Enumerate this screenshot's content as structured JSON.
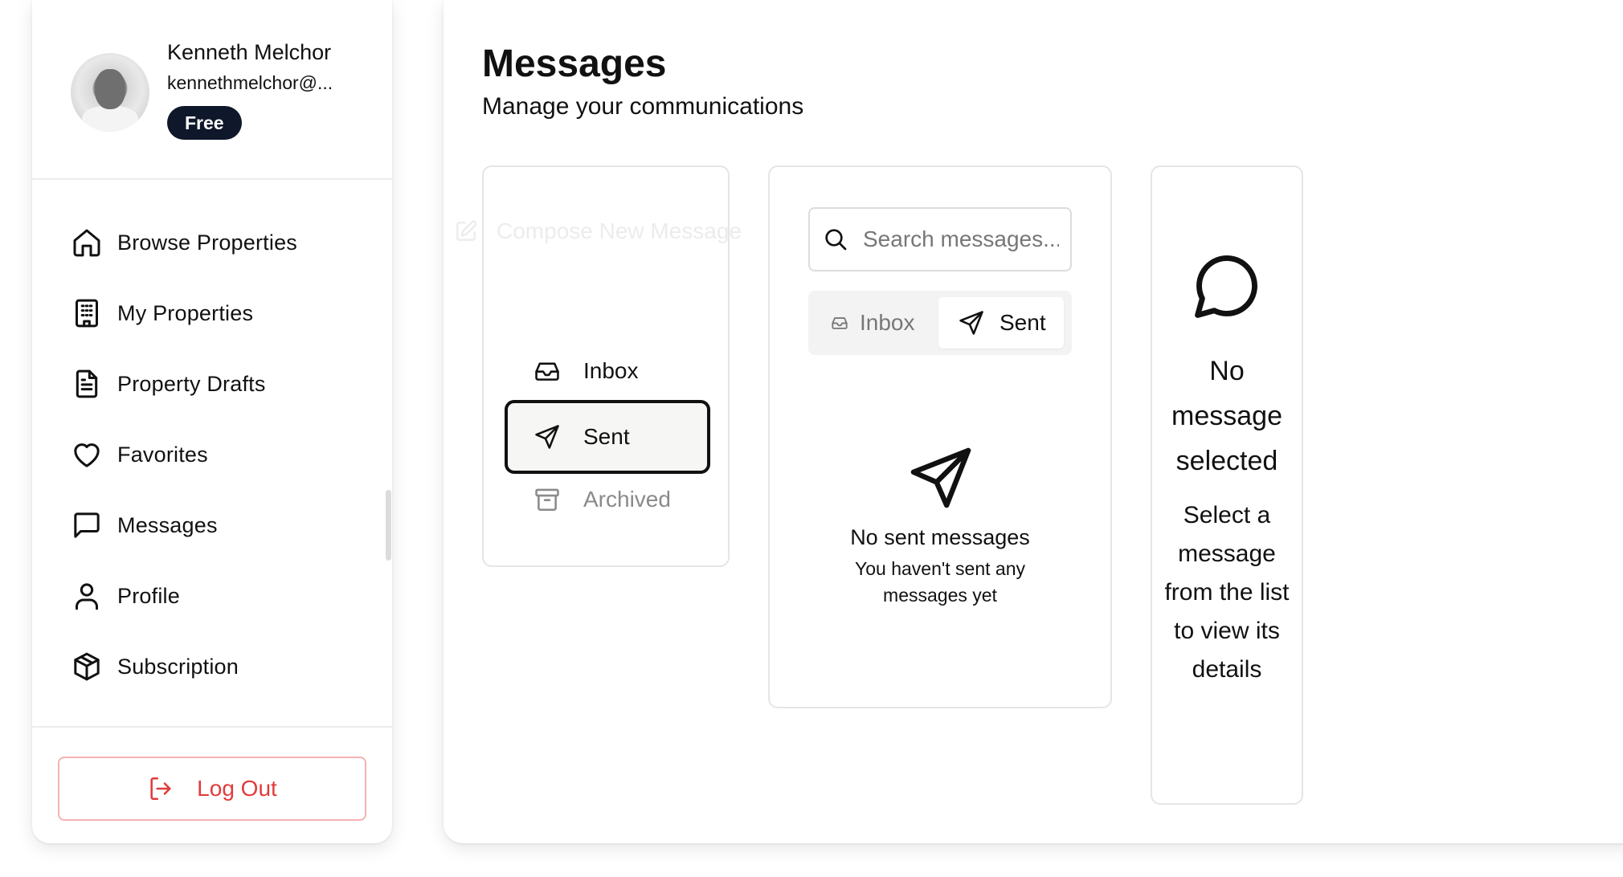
{
  "user": {
    "name": "Kenneth Melchor",
    "email": "kennethmelchor@...",
    "plan": "Free"
  },
  "nav": {
    "items": [
      {
        "label": "Browse Properties",
        "icon": "home-icon"
      },
      {
        "label": "My Properties",
        "icon": "building-icon"
      },
      {
        "label": "Property Drafts",
        "icon": "document-icon"
      },
      {
        "label": "Favorites",
        "icon": "heart-icon"
      },
      {
        "label": "Messages",
        "icon": "message-square-icon"
      },
      {
        "label": "Profile",
        "icon": "user-icon"
      },
      {
        "label": "Subscription",
        "icon": "package-icon"
      }
    ],
    "logout_label": "Log Out"
  },
  "page": {
    "title": "Messages",
    "subtitle": "Manage your communications"
  },
  "folders": {
    "compose_label": "Compose New Message",
    "items": [
      {
        "label": "Inbox",
        "icon": "inbox-icon"
      },
      {
        "label": "Sent",
        "icon": "send-icon",
        "selected": true
      },
      {
        "label": "Archived",
        "icon": "archive-icon"
      }
    ]
  },
  "message_list": {
    "search_placeholder": "Search messages...",
    "tabs": [
      {
        "label": "Inbox",
        "icon": "inbox-icon"
      },
      {
        "label": "Sent",
        "icon": "send-icon",
        "active": true
      }
    ],
    "empty_title": "No sent messages",
    "empty_description": "You haven't sent any messages yet"
  },
  "detail": {
    "empty_title": "No message selected",
    "empty_description": "Select a message from the list to view its details"
  },
  "colors": {
    "accent_dark": "#0f172a",
    "danger": "#e23b3b",
    "danger_border": "#f3b3b3",
    "muted_text": "#777777"
  }
}
